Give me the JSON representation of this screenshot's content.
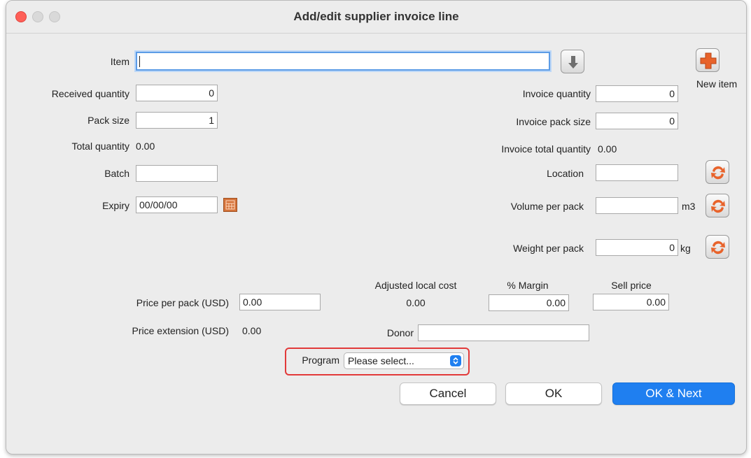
{
  "window": {
    "title": "Add/edit supplier invoice line"
  },
  "left": {
    "item_label": "Item",
    "item_value": "",
    "received_quantity_label": "Received quantity",
    "received_quantity_value": "0",
    "pack_size_label": "Pack size",
    "pack_size_value": "1",
    "total_quantity_label": "Total quantity",
    "total_quantity_value": "0.00",
    "batch_label": "Batch",
    "batch_value": "",
    "expiry_label": "Expiry",
    "expiry_value": "00/00/00"
  },
  "right": {
    "new_item_label": "New item",
    "invoice_quantity_label": "Invoice quantity",
    "invoice_quantity_value": "0",
    "invoice_pack_size_label": "Invoice pack size",
    "invoice_pack_size_value": "0",
    "invoice_total_quantity_label": "Invoice total quantity",
    "invoice_total_quantity_value": "0.00",
    "location_label": "Location",
    "location_value": "",
    "volume_per_pack_label": "Volume per pack",
    "volume_per_pack_value": "",
    "volume_unit": "m3",
    "weight_per_pack_label": "Weight per pack",
    "weight_per_pack_value": "0",
    "weight_unit": "kg"
  },
  "pricing": {
    "adjusted_local_cost_label": "Adjusted local cost",
    "adjusted_local_cost_value": "0.00",
    "margin_label": "% Margin",
    "margin_value": "0.00",
    "sell_price_label": "Sell price",
    "sell_price_value": "0.00",
    "price_per_pack_label": "Price per pack (USD)",
    "price_per_pack_value": "0.00",
    "price_extension_label": "Price extension (USD)",
    "price_extension_value": "0.00",
    "donor_label": "Donor",
    "donor_value": ""
  },
  "program": {
    "label": "Program",
    "selected": "Please select..."
  },
  "buttons": {
    "cancel": "Cancel",
    "ok": "OK",
    "ok_next": "OK & Next"
  },
  "colors": {
    "accent": "#1f7ff0",
    "highlight": "#e23a3a",
    "icon_orange": "#e8632b"
  }
}
